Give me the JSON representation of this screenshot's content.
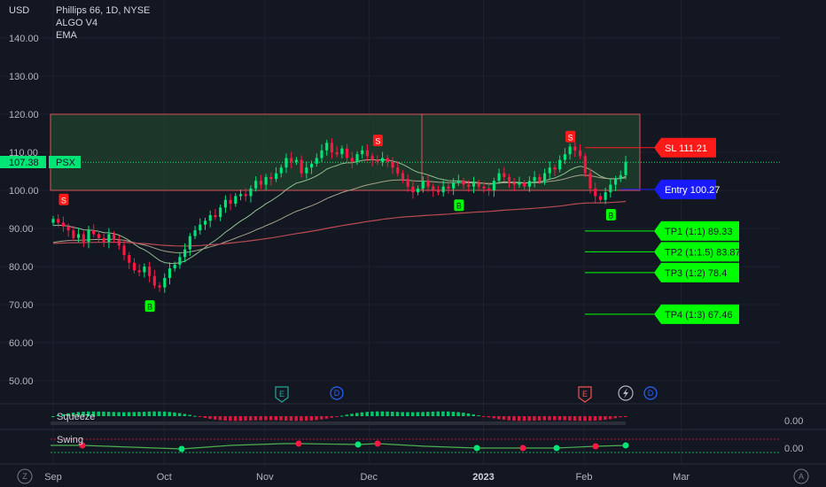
{
  "header": {
    "currency": "USD",
    "symbol_line": "Phillips 66, 1D, NYSE",
    "indicator1": "ALGO V4",
    "indicator2": "EMA"
  },
  "price_tag": {
    "symbol": "PSX",
    "value": "107.38"
  },
  "colors": {
    "background": "#131722",
    "up": "#00e676",
    "down": "#ff1744",
    "label_green": "#00ff00",
    "label_red": "#ff1a1a",
    "entry_blue": "#1a1aff",
    "zone_green": "#1e3d2a",
    "zone_border": "#e0515e"
  },
  "chart_data": {
    "type": "candlestick",
    "title": "Phillips 66, 1D, NYSE",
    "ylabel": "USD",
    "ylim": [
      40,
      145
    ],
    "y_ticks": [
      "140.00",
      "130.00",
      "120.00",
      "110.00",
      "100.00",
      "90.00",
      "80.00",
      "70.00",
      "60.00",
      "50.00"
    ],
    "x_ticks": [
      {
        "label": "Sep",
        "date": "2022-09-01"
      },
      {
        "label": "Oct",
        "date": "2022-10-03"
      },
      {
        "label": "Nov",
        "date": "2022-11-01"
      },
      {
        "label": "Dec",
        "date": "2022-12-01"
      },
      {
        "label": "2023",
        "date": "2023-01-03",
        "bold": true
      },
      {
        "label": "Feb",
        "date": "2023-02-01"
      },
      {
        "label": "Mar",
        "date": "2023-03-01"
      }
    ],
    "closes": [
      92.5,
      91.5,
      90.5,
      89.5,
      87.5,
      88.5,
      86.5,
      89.5,
      88.5,
      87.5,
      86.5,
      88.5,
      87.0,
      85.5,
      83.0,
      81.0,
      79.0,
      78.5,
      80.0,
      77.5,
      75.0,
      74.5,
      77.0,
      79.5,
      80.5,
      82.5,
      84.5,
      88.0,
      89.5,
      91.0,
      92.0,
      93.5,
      93.0,
      95.5,
      97.5,
      96.5,
      98.5,
      99.0,
      98.5,
      100.5,
      102.5,
      101.5,
      103.5,
      103.0,
      104.5,
      106.0,
      108.5,
      107.5,
      108.0,
      104.5,
      106.0,
      107.0,
      108.5,
      110.5,
      112.5,
      110.0,
      109.5,
      111.0,
      108.5,
      107.5,
      109.5,
      110.5,
      109.0,
      108.0,
      107.5,
      108.5,
      107.5,
      106.0,
      104.5,
      103.0,
      101.0,
      99.5,
      100.5,
      102.5,
      101.0,
      100.0,
      99.5,
      101.0,
      100.5,
      102.0,
      102.5,
      101.5,
      101.0,
      102.0,
      101.0,
      100.5,
      100.0,
      102.5,
      104.5,
      103.5,
      102.0,
      101.5,
      102.0,
      101.0,
      102.5,
      103.5,
      102.5,
      104.5,
      106.0,
      105.5,
      108.0,
      109.5,
      111.5,
      110.5,
      109.0,
      104.5,
      100.5,
      98.5,
      97.5,
      99.5,
      101.5,
      103.0,
      104.0,
      107.5
    ],
    "ema_fast": {
      "name": "EMA",
      "start": 90.5,
      "end": 102.5
    },
    "ema_slow": {
      "name": "EMA",
      "start": 86.0,
      "end": 96.5
    },
    "signals": [
      {
        "type": "S",
        "near_price": 97.5
      },
      {
        "type": "B",
        "near_price": 69.5
      },
      {
        "type": "S",
        "near_price": 113.0
      },
      {
        "type": "B",
        "near_price": 96.0
      },
      {
        "type": "S",
        "near_price": 114.0
      },
      {
        "type": "B",
        "near_price": 93.5
      }
    ],
    "zone": {
      "top": 120,
      "bottom": 100
    },
    "levels": [
      {
        "label": "SL 111.21",
        "value": 111.21,
        "kind": "sl"
      },
      {
        "label": "Entry 100.27",
        "value": 100.27,
        "kind": "entry"
      },
      {
        "label": "TP1 (1:1) 89.33",
        "value": 89.33,
        "kind": "tp"
      },
      {
        "label": "TP2 (1:1.5) 83.87",
        "value": 83.87,
        "kind": "tp"
      },
      {
        "label": "TP3 (1:2) 78.4",
        "value": 78.4,
        "kind": "tp"
      },
      {
        "label": "TP4 (1:3) 67.46",
        "value": 67.46,
        "kind": "tp"
      }
    ],
    "event_markers": [
      "E",
      "D",
      "E",
      "D"
    ],
    "panes": [
      {
        "name": "Squeeze",
        "value_label": "0.00"
      },
      {
        "name": "Swing",
        "value_label": "0.00"
      }
    ]
  },
  "footer": {
    "left_icon": "Z",
    "right_icon": "A"
  }
}
